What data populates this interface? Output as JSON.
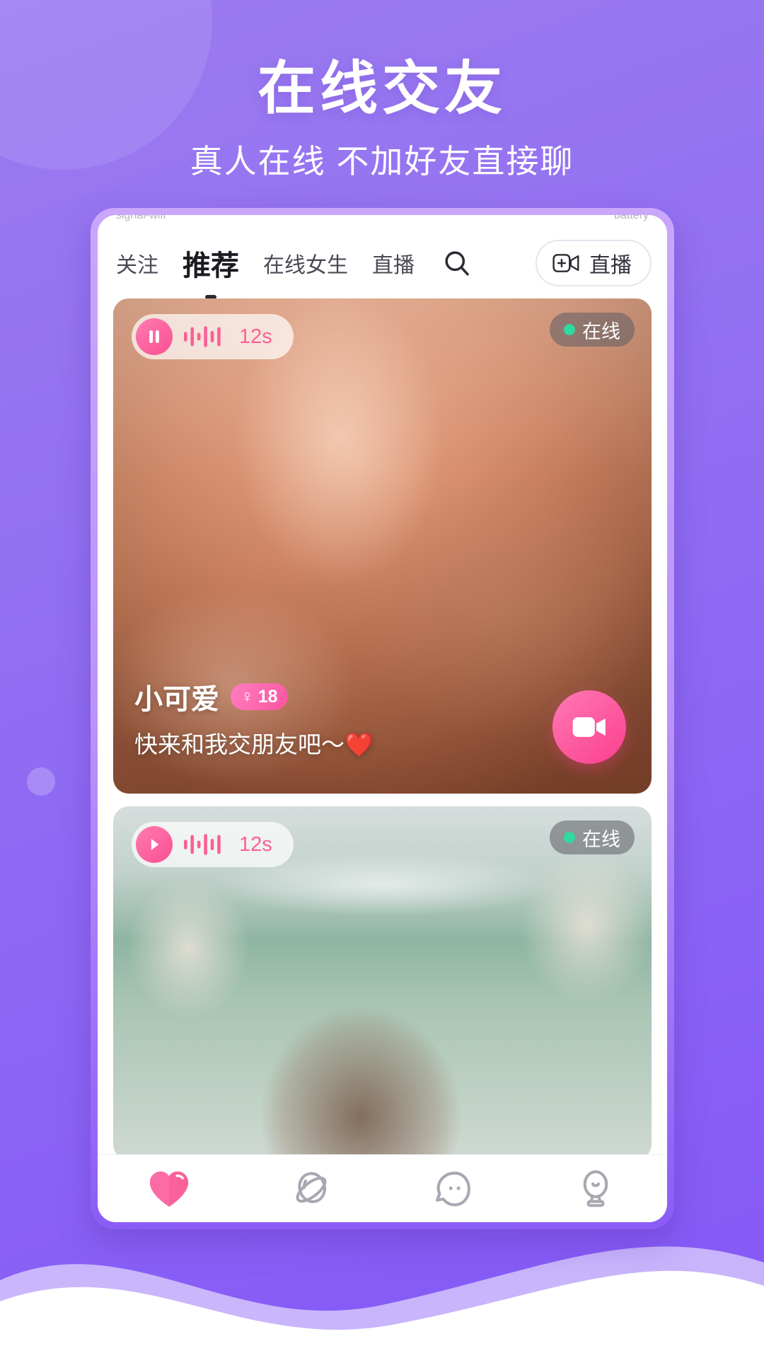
{
  "promo": {
    "title": "在线交友",
    "subtitle": "真人在线 不加好友直接聊"
  },
  "colors": {
    "bg_purple": "#8b63f5",
    "accent_pink": "#fb4f92",
    "online_green": "#2fd9a0",
    "nav_inactive": "#a8a8b2"
  },
  "statusbar": {
    "time": "",
    "left_icons": "signal-wifi",
    "right_icons": "battery"
  },
  "topnav": {
    "tabs": [
      {
        "label": "关注",
        "active": false,
        "name": "tab-follow"
      },
      {
        "label": "推荐",
        "active": true,
        "name": "tab-recommend"
      },
      {
        "label": "在线女生",
        "active": false,
        "name": "tab-online-girls"
      },
      {
        "label": "直播",
        "active": false,
        "name": "tab-live"
      }
    ],
    "search_icon": "search-icon",
    "live_button": {
      "label": "直播",
      "icon": "video-camera-plus-icon"
    }
  },
  "feed": {
    "cards": [
      {
        "name": "小可爱",
        "gender_symbol": "♀",
        "age": "18",
        "message": "快来和我交朋友吧～❤️",
        "audio": {
          "state_icon": "pause-icon",
          "duration": "12s",
          "waveform": "audio-waveform-icon"
        },
        "status": {
          "label": "在线",
          "dot_color": "#2fd9a0"
        },
        "action_icon": "video-call-icon"
      },
      {
        "name": "",
        "gender_symbol": "",
        "age": "",
        "message": "",
        "audio": {
          "state_icon": "play-icon",
          "duration": "12s",
          "waveform": "audio-waveform-icon"
        },
        "status": {
          "label": "在线",
          "dot_color": "#2fd9a0"
        },
        "action_icon": ""
      }
    ]
  },
  "bottomnav": {
    "items": [
      {
        "icon": "heart-icon",
        "name": "nav-discover",
        "active": true
      },
      {
        "icon": "planet-icon",
        "name": "nav-planet",
        "active": false
      },
      {
        "icon": "chat-face-icon",
        "name": "nav-messages",
        "active": false
      },
      {
        "icon": "person-icon",
        "name": "nav-profile",
        "active": false
      }
    ]
  }
}
